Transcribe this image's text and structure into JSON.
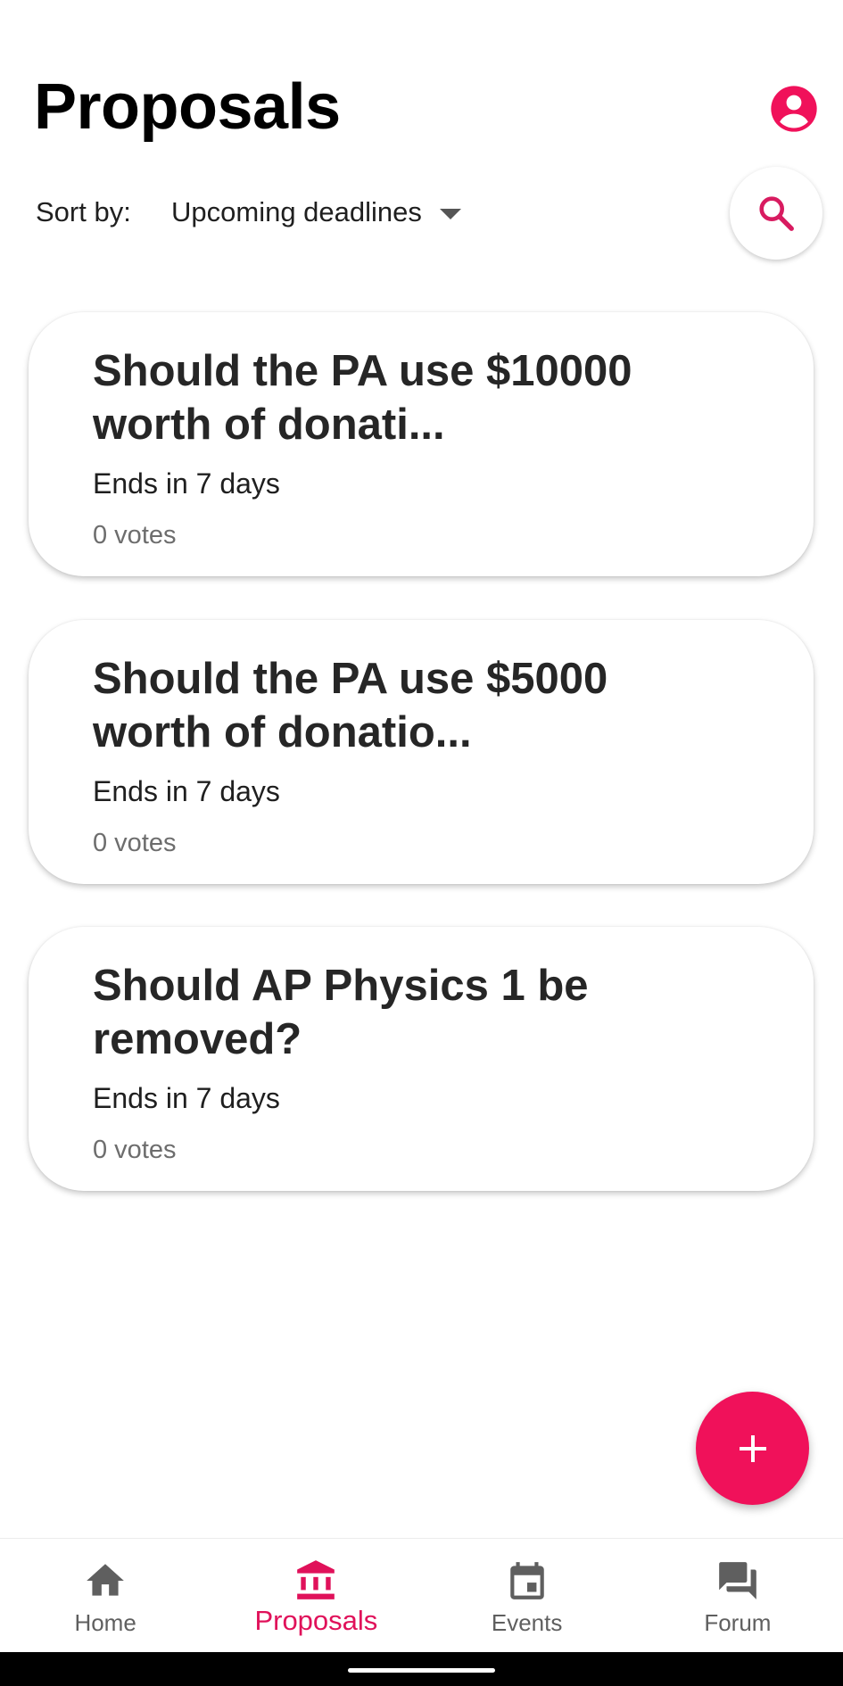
{
  "header": {
    "title": "Proposals"
  },
  "sort": {
    "label": "Sort by:",
    "selected": "Upcoming deadlines"
  },
  "colors": {
    "accent": "#f0115a",
    "text_primary": "#262626",
    "text_secondary": "#6d6d6d"
  },
  "proposals": [
    {
      "title_line1": "Should the PA use $10000",
      "title_line2": "worth of donati...",
      "ends": "Ends in 7 days",
      "votes": "0 votes"
    },
    {
      "title_line1": "Should the PA use $5000",
      "title_line2": "worth of donatio...",
      "ends": "Ends in 7 days",
      "votes": "0 votes"
    },
    {
      "title_line1": "Should AP Physics 1 be",
      "title_line2": "removed?",
      "ends": "Ends in 7 days",
      "votes": "0 votes"
    }
  ],
  "icons": {
    "account": "account-circle-icon",
    "search": "search-icon",
    "add": "plus-icon",
    "home": "home-icon",
    "proposals": "bank-icon",
    "events": "calendar-icon",
    "forum": "forum-icon"
  },
  "bottom_nav": {
    "items": [
      {
        "label": "Home"
      },
      {
        "label": "Proposals"
      },
      {
        "label": "Events"
      },
      {
        "label": "Forum"
      }
    ],
    "active_index": 1
  }
}
